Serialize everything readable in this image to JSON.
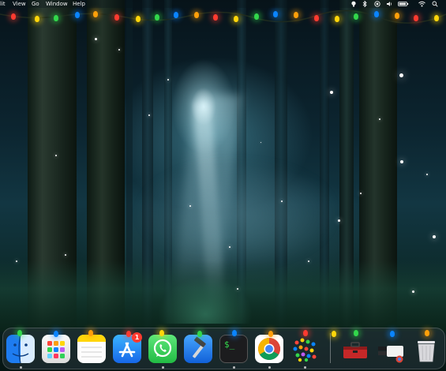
{
  "menubar": {
    "items": [
      "lit",
      "View",
      "Go",
      "Window",
      "Help"
    ]
  },
  "status_icons": [
    "bulb-icon",
    "bluetooth-icon",
    "record-icon",
    "volume-icon",
    "battery-icon",
    "wifi-icon",
    "search-icon"
  ],
  "desktop": {
    "wallpaper": "redwood-forest-night",
    "accent_colors": {
      "red": "#ff3b30",
      "yellow": "#ffd60a",
      "green": "#32d74b",
      "blue": "#0a84ff",
      "orange": "#ff9f0a"
    }
  },
  "dock": {
    "apps": [
      {
        "name": "Finder",
        "icon": "finder-icon",
        "running": true
      },
      {
        "name": "Launchpad",
        "icon": "launchpad-icon",
        "running": false
      },
      {
        "name": "Notes",
        "icon": "notes-icon",
        "running": false
      },
      {
        "name": "App Store",
        "icon": "app-store-icon",
        "running": false,
        "badge": "1"
      },
      {
        "name": "WhatsApp",
        "icon": "whatsapp-icon",
        "running": true
      },
      {
        "name": "Xcode",
        "icon": "xcode-icon",
        "running": false
      },
      {
        "name": "Terminal",
        "icon": "terminal-icon",
        "running": true
      },
      {
        "name": "Chrome",
        "icon": "chrome-icon",
        "running": true
      },
      {
        "name": "Lights",
        "icon": "lights-app-icon",
        "running": true
      }
    ],
    "extras": [
      {
        "name": "Toolbox",
        "icon": "toolbox-icon"
      },
      {
        "name": "Downloads",
        "icon": "downloads-stack-icon"
      },
      {
        "name": "Trash",
        "icon": "trash-icon"
      }
    ],
    "app_store_badge": "1",
    "terminal_prompt": "$_"
  }
}
